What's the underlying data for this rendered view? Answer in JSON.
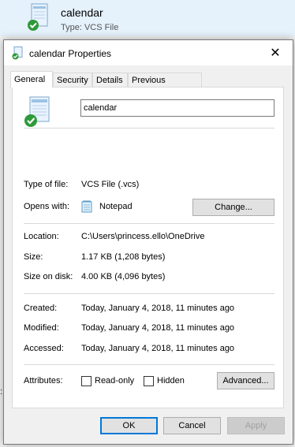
{
  "background_window": {
    "file_name": "calendar",
    "file_type_line": "Type: VCS File",
    "edge_text": ":"
  },
  "dialog": {
    "title": "calendar Properties",
    "close_glyph": "✕",
    "tabs": [
      {
        "label": "General",
        "active": true
      },
      {
        "label": "Security",
        "active": false
      },
      {
        "label": "Details",
        "active": false
      },
      {
        "label": "Previous Versions",
        "active": false
      }
    ],
    "general": {
      "file_name_value": "calendar",
      "type_of_file": {
        "label": "Type of file:",
        "value": "VCS File (.vcs)"
      },
      "opens_with": {
        "label": "Opens with:",
        "value": "Notepad",
        "change_button": "Change..."
      },
      "location": {
        "label": "Location:",
        "value": "C:\\Users\\princess.ello\\OneDrive"
      },
      "size": {
        "label": "Size:",
        "value": "1.17 KB (1,208 bytes)"
      },
      "size_on_disk": {
        "label": "Size on disk:",
        "value": "4.00 KB (4,096 bytes)"
      },
      "created": {
        "label": "Created:",
        "value": "Today, January 4, 2018, 11 minutes ago"
      },
      "modified": {
        "label": "Modified:",
        "value": "Today, January 4, 2018, 11 minutes ago"
      },
      "accessed": {
        "label": "Accessed:",
        "value": "Today, January 4, 2018, 11 minutes ago"
      },
      "attributes": {
        "label": "Attributes:",
        "read_only": {
          "label": "Read-only",
          "checked": false
        },
        "hidden": {
          "label": "Hidden",
          "checked": false
        },
        "advanced_button": "Advanced..."
      }
    },
    "footer": {
      "ok": "OK",
      "cancel": "Cancel",
      "apply": "Apply"
    }
  },
  "colors": {
    "dialog_bg": "#f0f0f0",
    "accent": "#0078d7",
    "icon_check": "#2e9a3a"
  },
  "icons": {
    "file_icon": "vcs-calendar-file-icon",
    "notepad_icon": "notepad-icon"
  }
}
